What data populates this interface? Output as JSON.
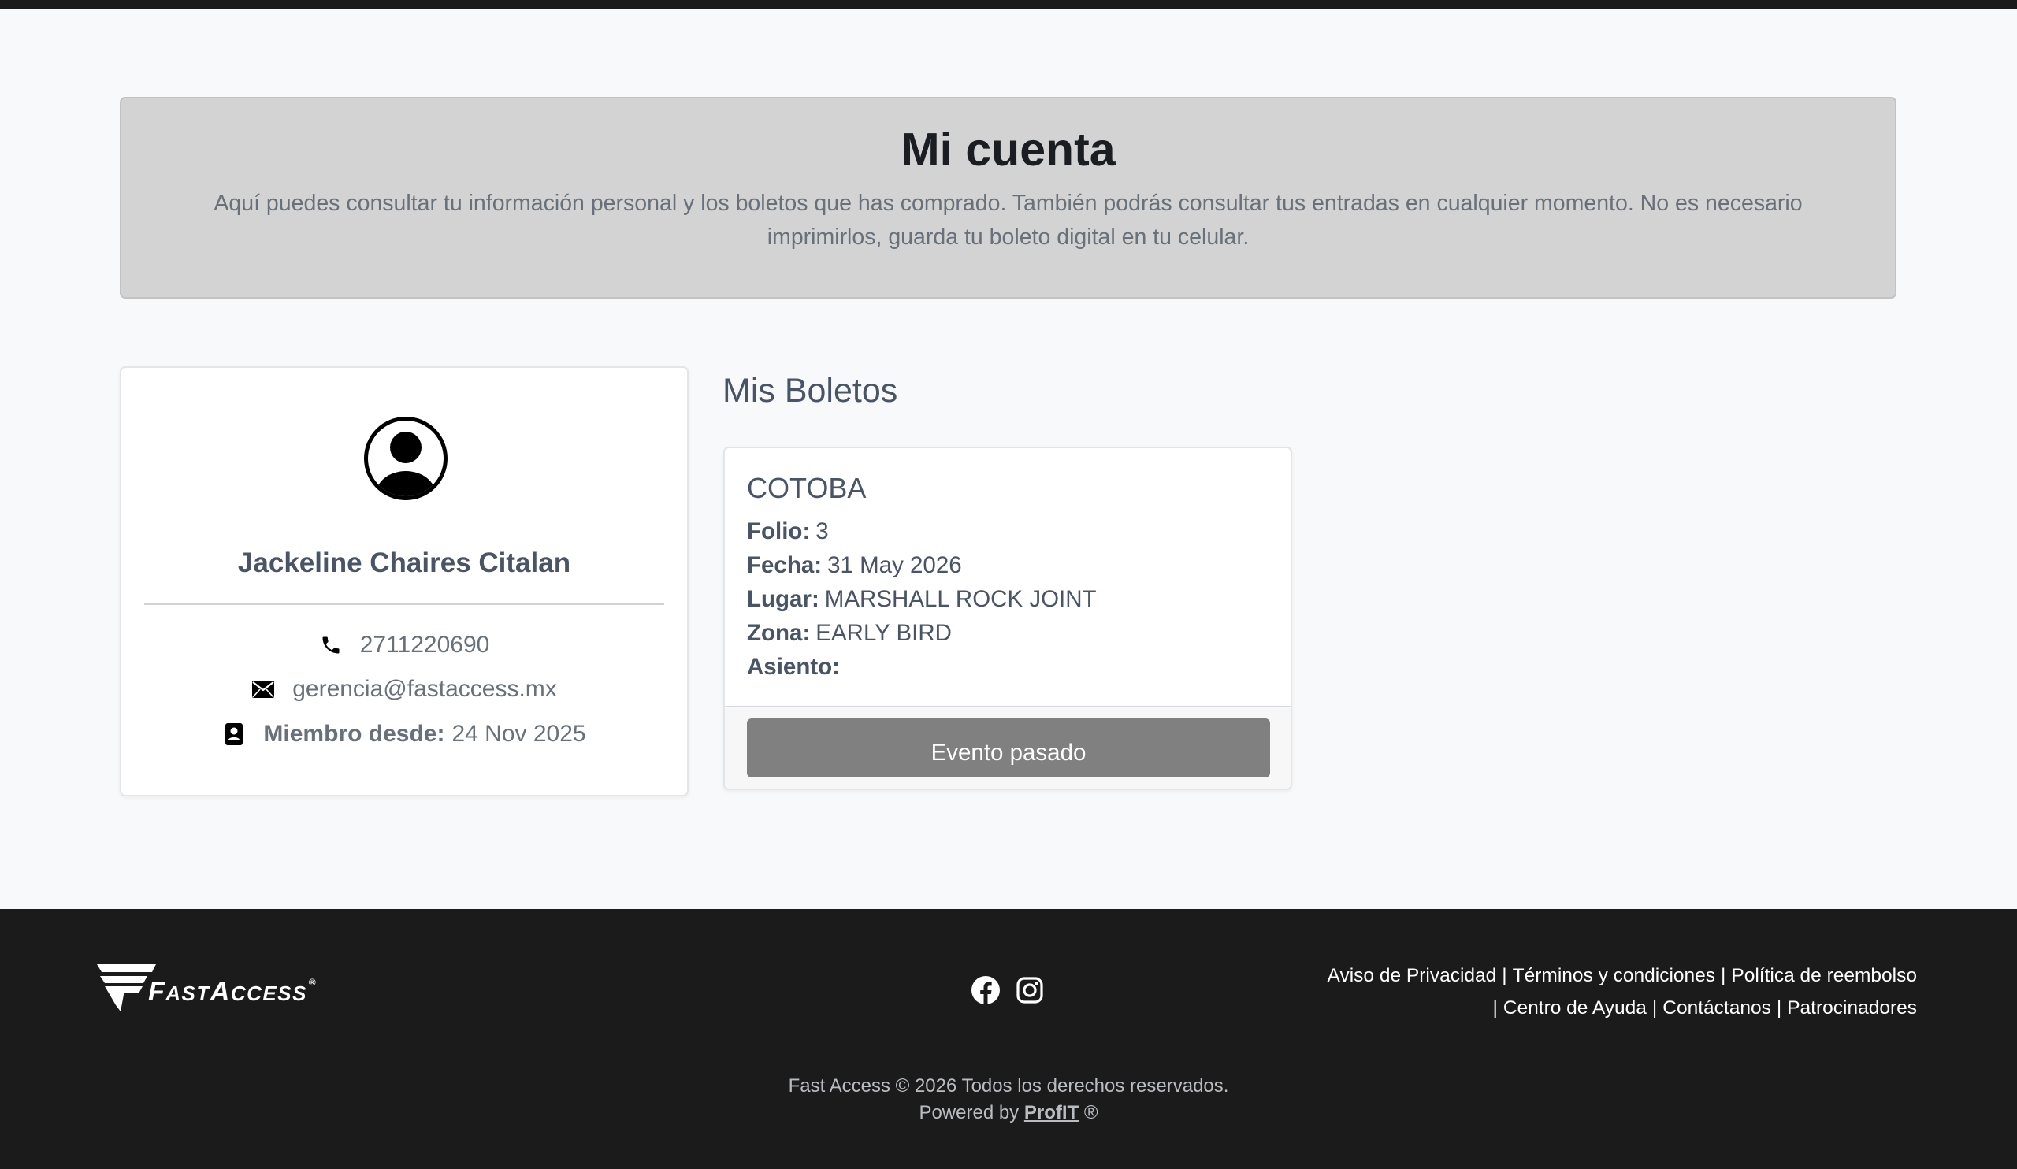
{
  "hero": {
    "title": "Mi cuenta",
    "description": "Aquí puedes consultar tu información personal y los boletos que has comprado. También podrás consultar tus entradas en cualquier momento. No es necesario imprimirlos, guarda tu boleto digital en tu celular."
  },
  "profile": {
    "name": "Jackeline Chaires Citalan",
    "phone": "2711220690",
    "email": "gerencia@fastaccess.mx",
    "member_label": "Miembro desde:",
    "member_since": "24 Nov 2025",
    "icons": [
      "user-circle-icon",
      "phone-icon",
      "envelope-icon",
      "contact-card-icon"
    ]
  },
  "tickets": {
    "title": "Mis Boletos",
    "items": [
      {
        "event": "COTOBA",
        "folio_label": "Folio:",
        "folio": "3",
        "fecha_label": "Fecha:",
        "fecha": "31 May 2026",
        "lugar_label": "Lugar:",
        "lugar": "MARSHALL ROCK JOINT",
        "zona_label": "Zona:",
        "zona": "EARLY BIRD",
        "asiento_label": "Asiento:",
        "asiento": "",
        "status_button": "Evento pasado"
      }
    ]
  },
  "footer": {
    "logo_text": "FastAccess",
    "social_icons": [
      "facebook-icon",
      "instagram-icon"
    ],
    "links": {
      "privacy": "Aviso de Privacidad",
      "terms": "Términos y condiciones",
      "refund": "Política de reembolso",
      "help": "Centro de Ayuda",
      "contact": "Contáctanos",
      "sponsors": "Patrocinadores",
      "separator": "|"
    },
    "copyright": "Fast Access © 2026 Todos los derechos reservados.",
    "powered_prefix": "Powered by",
    "powered_link": "ProfIT",
    "powered_suffix": "®"
  },
  "colors": {
    "top_bar": "#1b1b1b",
    "hero_bg": "#d3d3d3",
    "text_primary": "#495466",
    "button_disabled": "#808080",
    "footer_bg": "#1b1b1b"
  }
}
